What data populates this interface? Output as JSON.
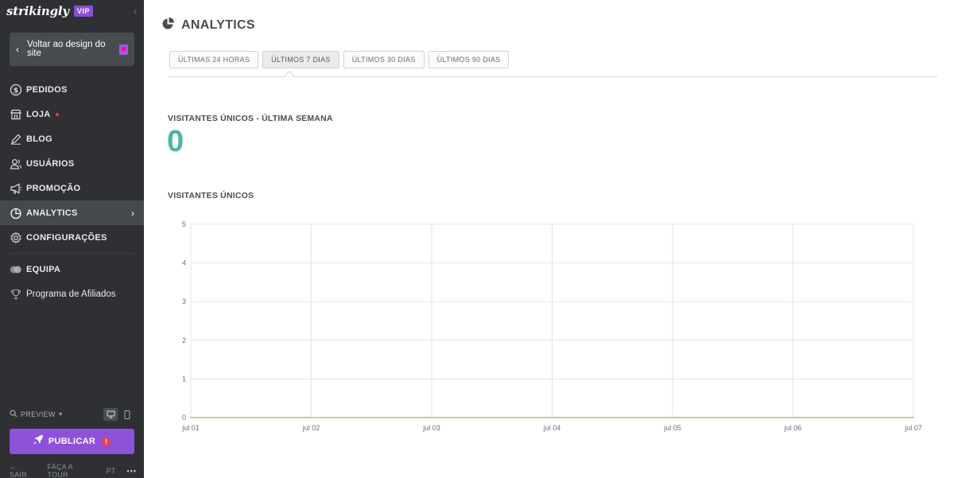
{
  "sidebar": {
    "brand": "strikingly",
    "vip": "VIP",
    "back_label": "Voltar ao design do site",
    "items": [
      {
        "label": "PEDIDOS"
      },
      {
        "label": "LOJA"
      },
      {
        "label": "BLOG"
      },
      {
        "label": "USUÁRIOS"
      },
      {
        "label": "PROMOÇÃO"
      },
      {
        "label": "ANALYTICS"
      },
      {
        "label": "CONFIGURAÇÕES"
      },
      {
        "label": "EQUIPA"
      },
      {
        "label": "Programa de Afiliados"
      }
    ],
    "preview_label": "PREVIEW",
    "publish_label": "PUBLICAR",
    "footer": {
      "logout": "SAIR",
      "tour": "FAÇA A TOUR",
      "lang": "PT"
    }
  },
  "main": {
    "title": "ANALYTICS",
    "tabs": [
      "ÚLTIMAS 24 HORAS",
      "ÚLTIMOS 7 DIAS",
      "ÚLTIMOS 30 DIAS",
      "ÚLTIMOS 90 DIAS"
    ],
    "active_tab": 1,
    "stat_label": "VISITANTES ÚNICOS - ÚLTIMA SEMANA",
    "stat_value": "0",
    "chart_label": "VISITANTES ÚNICOS"
  },
  "colors": {
    "accent": "#8e51d9",
    "stat": "#4db6a4",
    "sidebar": "#2e3033",
    "line": "#a8c686"
  },
  "chart_data": {
    "type": "line",
    "categories": [
      "jul 01",
      "jul 02",
      "jul 03",
      "jul 04",
      "jul 05",
      "jul 06",
      "jul 07"
    ],
    "series": [
      {
        "values": [
          0,
          0,
          0,
          0,
          0,
          0,
          0
        ]
      }
    ],
    "yticks": [
      0,
      1,
      2,
      3,
      4,
      5
    ],
    "ylim": [
      0,
      5
    ],
    "grid": true,
    "title": "VISITANTES ÚNICOS"
  }
}
